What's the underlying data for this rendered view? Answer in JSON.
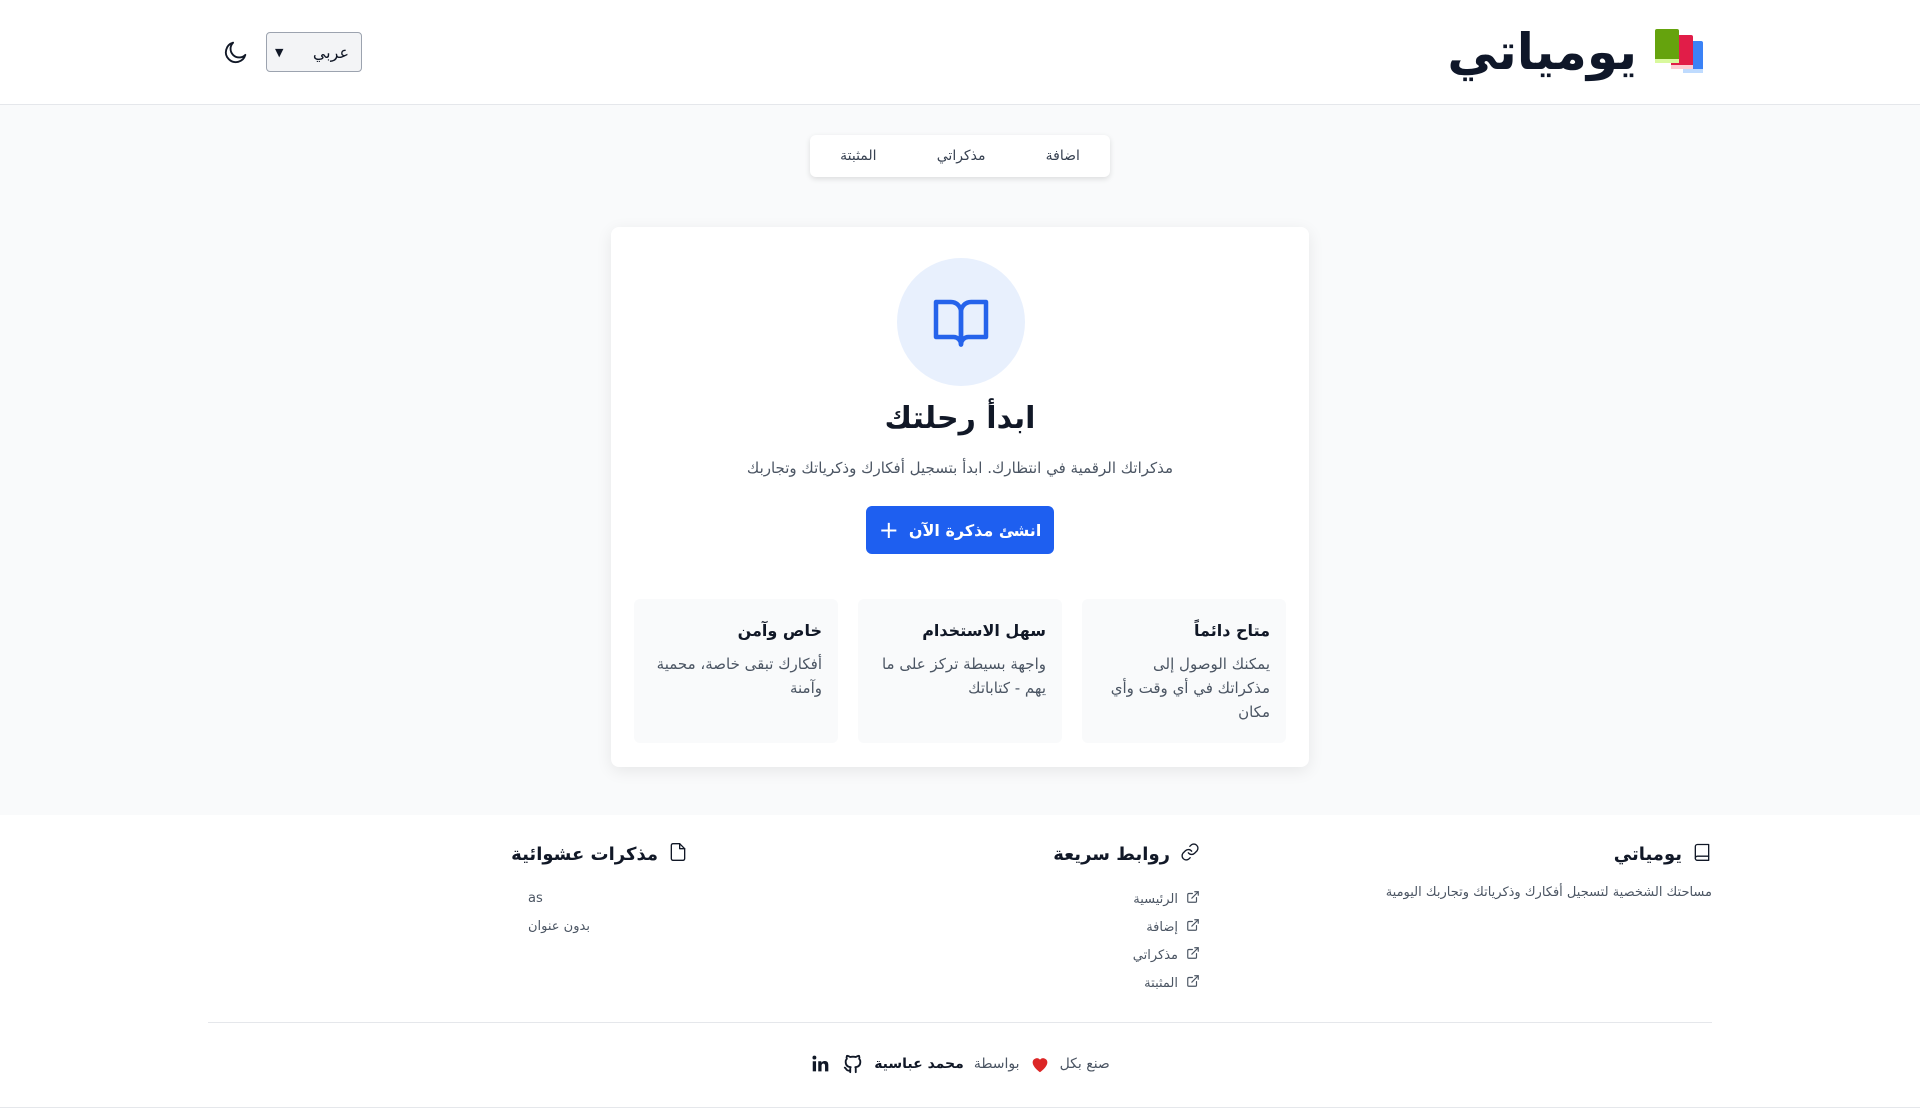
{
  "header": {
    "title": "يومياتي",
    "language": {
      "selected": "عربي"
    }
  },
  "tabs": [
    {
      "label": "اضافة"
    },
    {
      "label": "مذكراتي"
    },
    {
      "label": "المثبتة"
    }
  ],
  "hero": {
    "title": "ابدأ رحلتك",
    "subtitle": "مذكراتك الرقمية في انتظارك. ابدأ بتسجيل أفكارك وذكرياتك وتجاربك",
    "cta_label": "انشئ مذكرة الآن",
    "features": [
      {
        "title": "متاح دائماً",
        "text": "يمكنك الوصول إلى مذكراتك في أي وقت وأي مكان"
      },
      {
        "title": "سهل الاستخدام",
        "text": "واجهة بسيطة تركز على ما يهم - كتاباتك"
      },
      {
        "title": "خاص وآمن",
        "text": "أفكارك تبقى خاصة، محمية وآمنة"
      }
    ]
  },
  "footer": {
    "about": {
      "title": "يومياتي",
      "description": "مساحتك الشخصية لتسجيل أفكارك وذكرياتك وتجاربك اليومية"
    },
    "quick_links": {
      "title": "روابط سريعة",
      "items": [
        "الرئيسية",
        "إضافة",
        "مذكراتي",
        "المثبتة"
      ]
    },
    "random_notes": {
      "title": "مذكرات عشوائية",
      "items": [
        "as",
        "بدون عنوان"
      ]
    },
    "credits": {
      "made_with": "صنع بكل",
      "by": "بواسطة",
      "author": "محمد عباسية"
    }
  },
  "icons": {
    "brand": "books-icon",
    "theme_toggle": "moon-icon",
    "hero": "open-book-icon",
    "cta": "plus-icon",
    "about": "book-icon",
    "quick_links": "link-icon",
    "random_notes": "file-icon",
    "external": "external-link-icon",
    "heart": "heart-icon",
    "github": "github-icon",
    "linkedin": "linkedin-icon"
  },
  "colors": {
    "primary": "#1e5ff0",
    "hero_circle_bg": "#e8f0fd",
    "heart": "#dc2626",
    "page_bg": "#f9fafb"
  }
}
